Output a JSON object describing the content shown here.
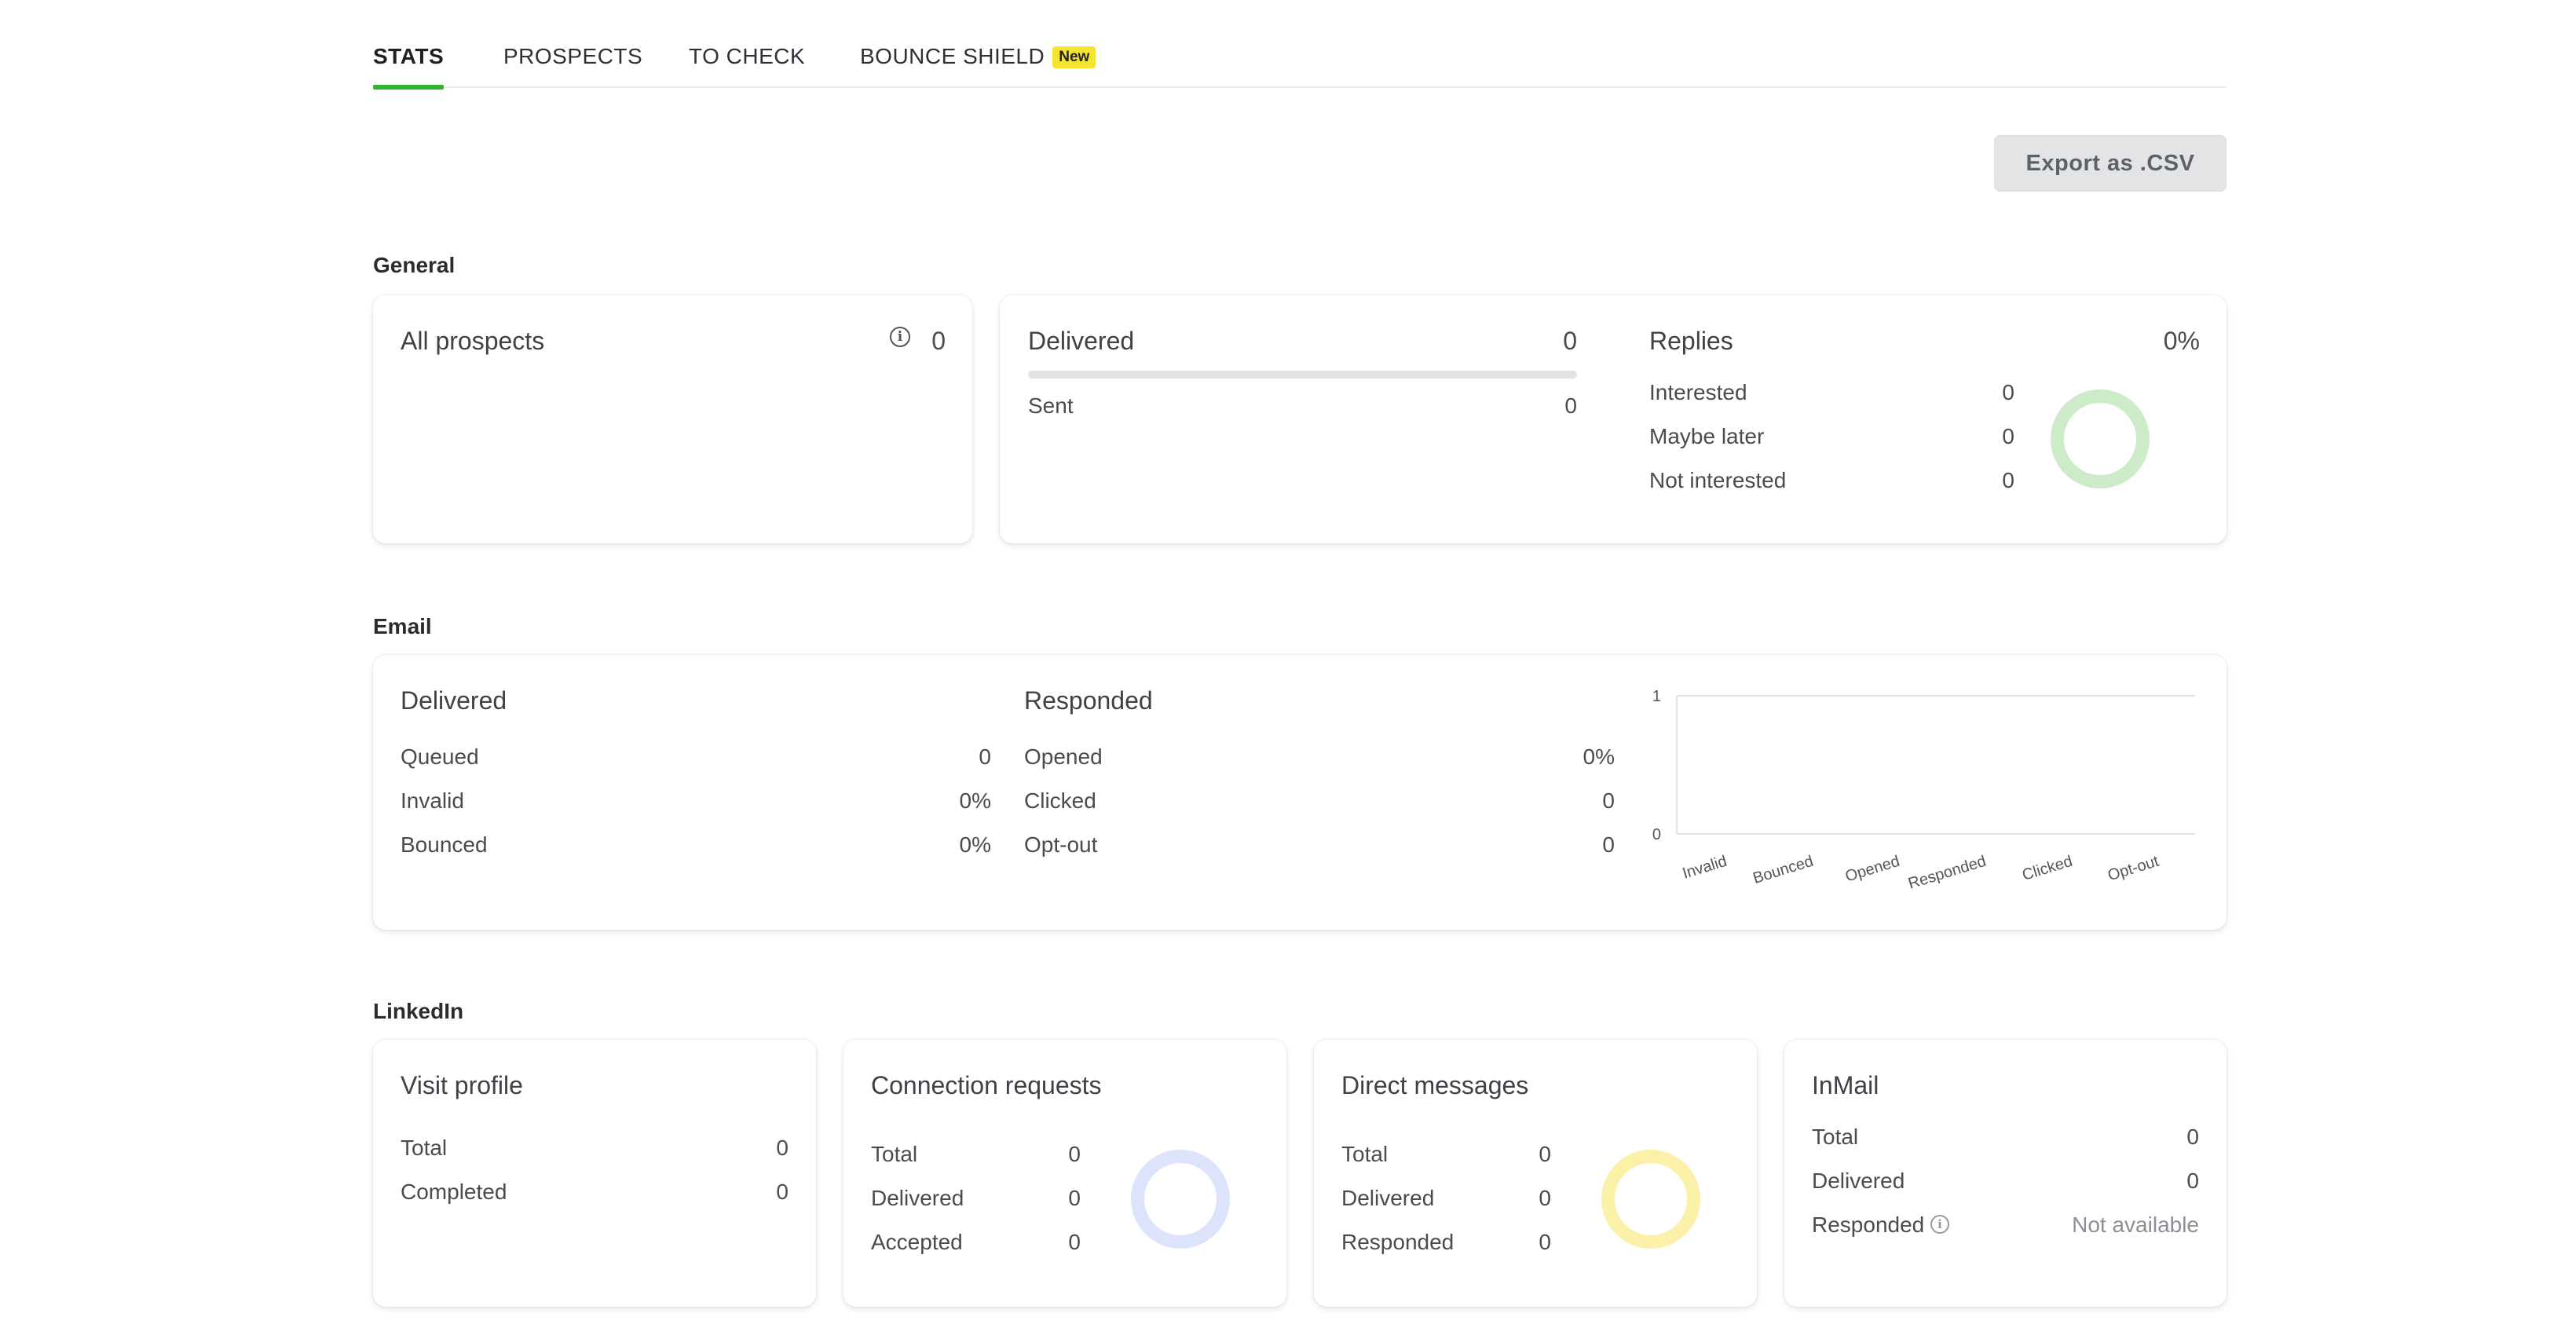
{
  "tabs": [
    {
      "label": "STATS",
      "active": true
    },
    {
      "label": "PROSPECTS",
      "active": false
    },
    {
      "label": "TO CHECK",
      "active": false
    },
    {
      "label": "BOUNCE SHIELD",
      "badge": "New",
      "active": false
    }
  ],
  "export_label": "Export as .CSV",
  "colors": {
    "accent": "#2db52d",
    "badge": "#f5e531",
    "replies_donut": "#cdebc8",
    "connection_donut": "#dde3fa",
    "direct_donut": "#fbf1a9"
  },
  "general": {
    "title": "General",
    "all_prospects": {
      "label": "All prospects",
      "value": "0",
      "icon": "info-icon"
    },
    "delivered": {
      "label": "Delivered",
      "value": "0",
      "progress": 0,
      "sent_label": "Sent",
      "sent_value": "0"
    },
    "replies": {
      "label": "Replies",
      "value": "0%",
      "rows": [
        {
          "label": "Interested",
          "value": "0"
        },
        {
          "label": "Maybe later",
          "value": "0"
        },
        {
          "label": "Not interested",
          "value": "0"
        }
      ]
    }
  },
  "email": {
    "title": "Email",
    "delivered": {
      "label": "Delivered",
      "rows": [
        {
          "label": "Queued",
          "value": "0"
        },
        {
          "label": "Invalid",
          "value": "0%"
        },
        {
          "label": "Bounced",
          "value": "0%"
        }
      ]
    },
    "responded": {
      "label": "Responded",
      "rows": [
        {
          "label": "Opened",
          "value": "0%"
        },
        {
          "label": "Clicked",
          "value": "0"
        },
        {
          "label": "Opt-out",
          "value": "0"
        }
      ]
    }
  },
  "chart_data": {
    "type": "bar",
    "categories": [
      "Invalid",
      "Bounced",
      "Opened",
      "Responded",
      "Clicked",
      "Opt-out"
    ],
    "values": [
      0,
      0,
      0,
      0,
      0,
      0
    ],
    "yticks": [
      "0",
      "1"
    ],
    "ylim": [
      0,
      1
    ],
    "grid": true,
    "title": "",
    "xlabel": "",
    "ylabel": ""
  },
  "linkedin": {
    "title": "LinkedIn",
    "visit_profile": {
      "label": "Visit profile",
      "rows": [
        {
          "label": "Total",
          "value": "0"
        },
        {
          "label": "Completed",
          "value": "0"
        }
      ]
    },
    "connection_requests": {
      "label": "Connection requests",
      "rows": [
        {
          "label": "Total",
          "value": "0"
        },
        {
          "label": "Delivered",
          "value": "0"
        },
        {
          "label": "Accepted",
          "value": "0"
        }
      ]
    },
    "direct_messages": {
      "label": "Direct messages",
      "rows": [
        {
          "label": "Total",
          "value": "0"
        },
        {
          "label": "Delivered",
          "value": "0"
        },
        {
          "label": "Responded",
          "value": "0"
        }
      ]
    },
    "inmail": {
      "label": "InMail",
      "rows": [
        {
          "label": "Total",
          "value": "0"
        },
        {
          "label": "Delivered",
          "value": "0"
        },
        {
          "label": "Responded",
          "value": "Not available",
          "icon": "info-icon"
        }
      ]
    }
  }
}
